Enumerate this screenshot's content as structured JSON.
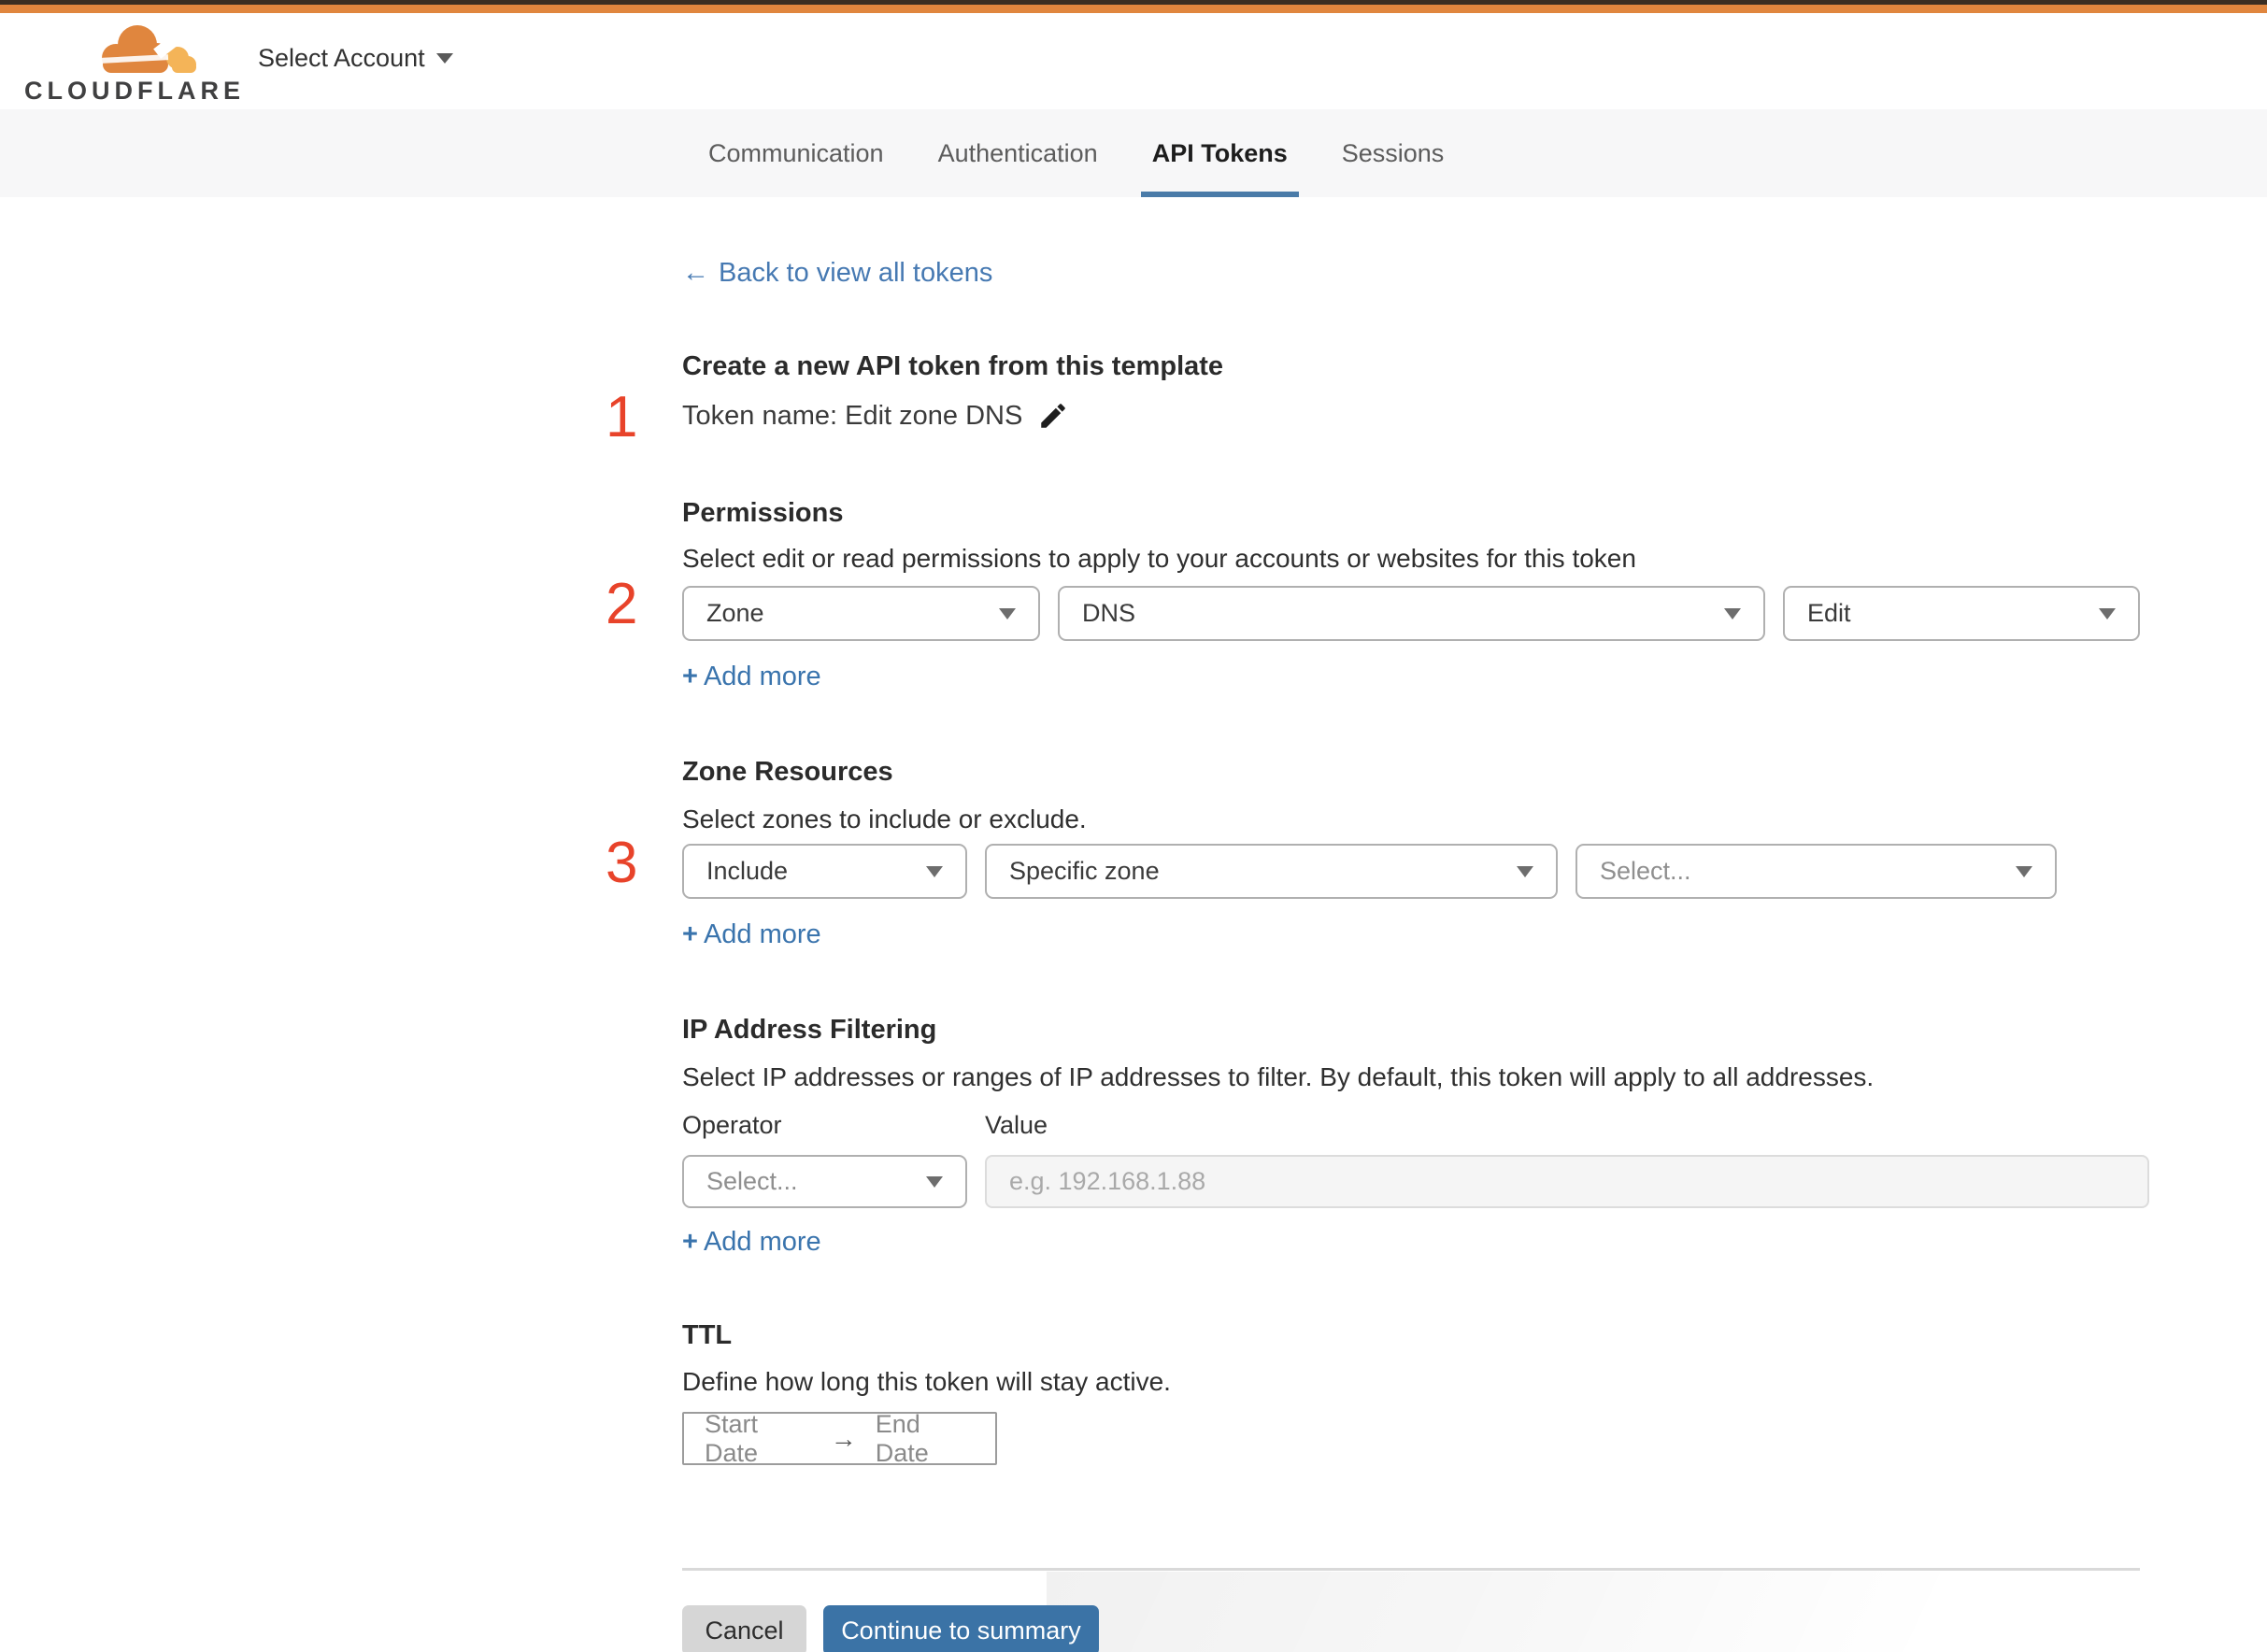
{
  "header": {
    "brand": "CLOUDFLARE",
    "account_selector": "Select Account"
  },
  "tabs": [
    {
      "label": "Communication",
      "active": false
    },
    {
      "label": "Authentication",
      "active": false
    },
    {
      "label": "API Tokens",
      "active": true
    },
    {
      "label": "Sessions",
      "active": false
    }
  ],
  "icons": {
    "back_arrow": "←",
    "date_arrow": "→",
    "plus": "+"
  },
  "back_link": "Back to view all tokens",
  "token_section": {
    "step": "1",
    "title": "Create a new API token from this template",
    "token_name": "Token name: Edit zone DNS"
  },
  "permissions": {
    "step": "2",
    "title": "Permissions",
    "description": "Select edit or read permissions to apply to your accounts or websites for this token",
    "scope_value": "Zone",
    "resource_value": "DNS",
    "access_value": "Edit",
    "add_more": "Add more"
  },
  "zone_resources": {
    "step": "3",
    "title": "Zone Resources",
    "description": "Select zones to include or exclude.",
    "mode_value": "Include",
    "scope_value": "Specific zone",
    "zone_placeholder": "Select...",
    "add_more": "Add more"
  },
  "ip_filtering": {
    "title": "IP Address Filtering",
    "description": "Select IP addresses or ranges of IP addresses to filter. By default, this token will apply to all addresses.",
    "operator_label": "Operator",
    "value_label": "Value",
    "operator_placeholder": "Select...",
    "value_placeholder": "e.g. 192.168.1.88",
    "add_more": "Add more"
  },
  "ttl": {
    "title": "TTL",
    "description": "Define how long this token will stay active.",
    "start_date": "Start Date",
    "end_date": "End Date"
  },
  "footer": {
    "cancel": "Cancel",
    "continue": "Continue to summary"
  },
  "colors": {
    "accent_orange": "#e0863e",
    "step_red": "#e8432a",
    "link_blue": "#3a74ad",
    "button_blue": "#3b73a6",
    "tab_underline_blue": "#4a7ba8"
  }
}
